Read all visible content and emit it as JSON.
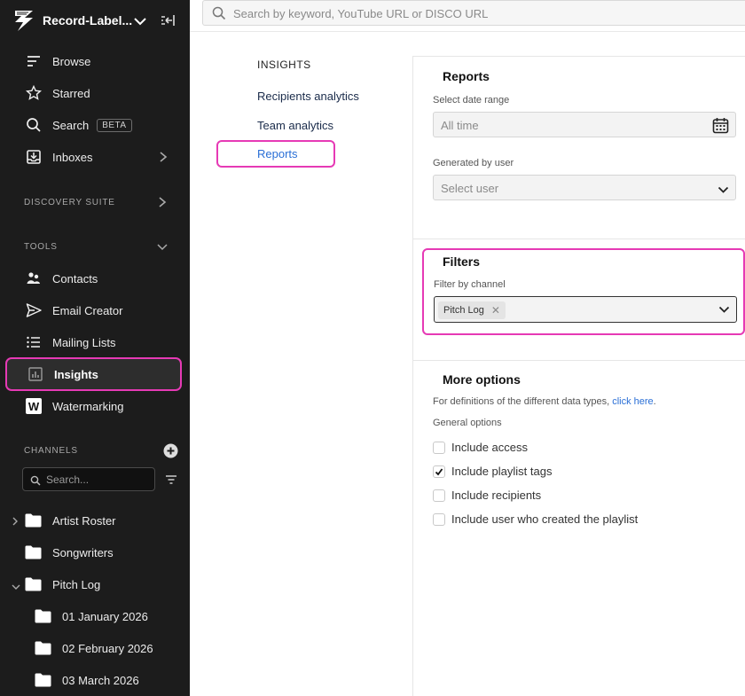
{
  "app": {
    "workspace_name": "Record-Label..."
  },
  "search": {
    "placeholder": "Search by keyword, YouTube URL or DISCO URL"
  },
  "sidebar": {
    "main_items": [
      {
        "label": "Browse",
        "icon": "browse-icon"
      },
      {
        "label": "Starred",
        "icon": "star-icon"
      },
      {
        "label": "Search",
        "icon": "search-icon",
        "badge": "BETA"
      },
      {
        "label": "Inboxes",
        "icon": "inbox-icon"
      }
    ],
    "discovery_suite_label": "DISCOVERY SUITE",
    "tools_label": "TOOLS",
    "tools": [
      {
        "label": "Contacts",
        "icon": "contacts-icon"
      },
      {
        "label": "Email Creator",
        "icon": "send-icon"
      },
      {
        "label": "Mailing Lists",
        "icon": "list-icon"
      },
      {
        "label": "Insights",
        "icon": "chart-icon",
        "active": true
      },
      {
        "label": "Watermarking",
        "icon": "watermark-icon"
      }
    ],
    "channels_label": "CHANNELS",
    "channel_search_placeholder": "Search...",
    "channels": [
      {
        "label": "Artist Roster",
        "expanded": false
      },
      {
        "label": "Songwriters"
      },
      {
        "label": "Pitch Log",
        "expanded": true
      },
      {
        "label": "01 January 2026",
        "child": true
      },
      {
        "label": "02 February 2026",
        "child": true
      },
      {
        "label": "03 March 2026",
        "child": true
      }
    ]
  },
  "insights_nav": {
    "title": "INSIGHTS",
    "links": [
      "Recipients analytics",
      "Team analytics",
      "Reports"
    ],
    "active": "Reports"
  },
  "reports": {
    "title": "Reports",
    "date_range_label": "Select date range",
    "date_range_value": "All time",
    "generated_by_label": "Generated by user",
    "generated_by_placeholder": "Select user"
  },
  "filters": {
    "title": "Filters",
    "channel_label": "Filter by channel",
    "selected_channel": "Pitch Log"
  },
  "more_options": {
    "title": "More options",
    "description": "For definitions of the different data types,",
    "link_text": "click here",
    "general_label": "General options",
    "options": [
      {
        "label": "Include access",
        "checked": false
      },
      {
        "label": "Include playlist tags",
        "checked": true
      },
      {
        "label": "Include recipients",
        "checked": false
      },
      {
        "label": "Include user who created the playlist",
        "checked": false
      }
    ]
  },
  "colors": {
    "highlight": "#e63ab5",
    "link": "#2a6fd6",
    "sidebar_bg": "#1c1c1c"
  }
}
